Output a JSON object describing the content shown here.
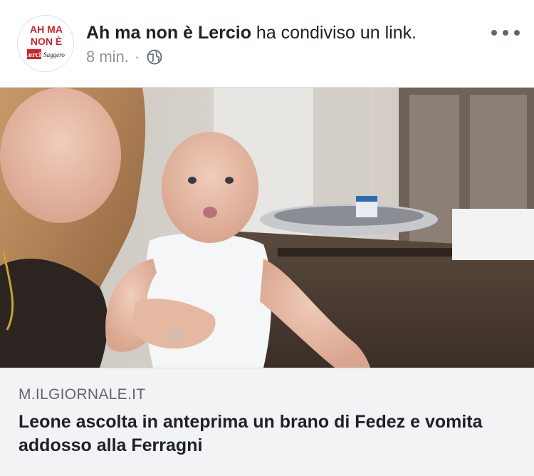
{
  "post": {
    "author": "Ah ma non è Lercio",
    "action": " ha condiviso un link.",
    "time": "8 min.",
    "separator": "·",
    "privacy_icon": "globe-icon",
    "more_icon": "more-dots-icon"
  },
  "avatar": {
    "line1": "AH MA",
    "line2": "NON È",
    "logo_text": "Lercio",
    "logo_subtext": "Saggero",
    "colors": {
      "text": "#d0232a",
      "badge": "#d0232a"
    }
  },
  "link": {
    "domain": "M.ILGIORNALE.IT",
    "title": "Leone ascolta in anteprima un brano di Fedez e vomita addosso alla Ferragni"
  },
  "colors": {
    "name_text": "#1d2129",
    "meta_text": "#90949c",
    "card_bg": "#f2f3f5"
  }
}
